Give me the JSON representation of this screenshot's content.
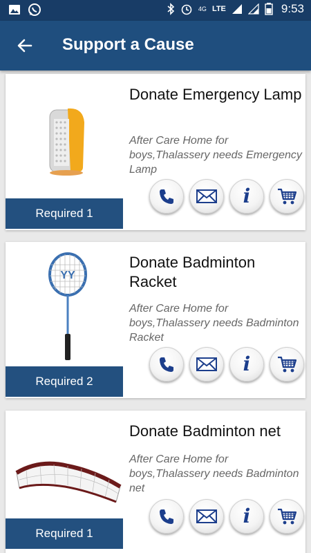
{
  "status_bar": {
    "time": "9:53",
    "network": "LTE",
    "network_gen": "4G"
  },
  "app_bar": {
    "title": "Support a Cause",
    "back_icon": "arrow-left-icon"
  },
  "colors": {
    "status_bar": "#183c66",
    "app_bar": "#1f4e7e",
    "badge": "#23507f",
    "icon_blue": "#1c3e8c"
  },
  "causes": [
    {
      "title": "Donate Emergency Lamp",
      "description": "After Care Home for boys,Thalassery needs Emergency Lamp",
      "required": "Required 1",
      "image_icon": "emergency-lamp-icon"
    },
    {
      "title": "Donate Badminton Racket",
      "description": "After Care Home for boys,Thalassery needs Badminton Racket",
      "required": "Required 2",
      "image_icon": "badminton-racket-icon"
    },
    {
      "title": "Donate Badminton net",
      "description": "After Care Home for boys,Thalassery needs Badminton net",
      "required": "Required 1",
      "image_icon": "badminton-net-icon"
    }
  ],
  "actions": [
    {
      "icon": "phone-icon"
    },
    {
      "icon": "mail-icon"
    },
    {
      "icon": "info-icon"
    },
    {
      "icon": "cart-icon"
    }
  ]
}
